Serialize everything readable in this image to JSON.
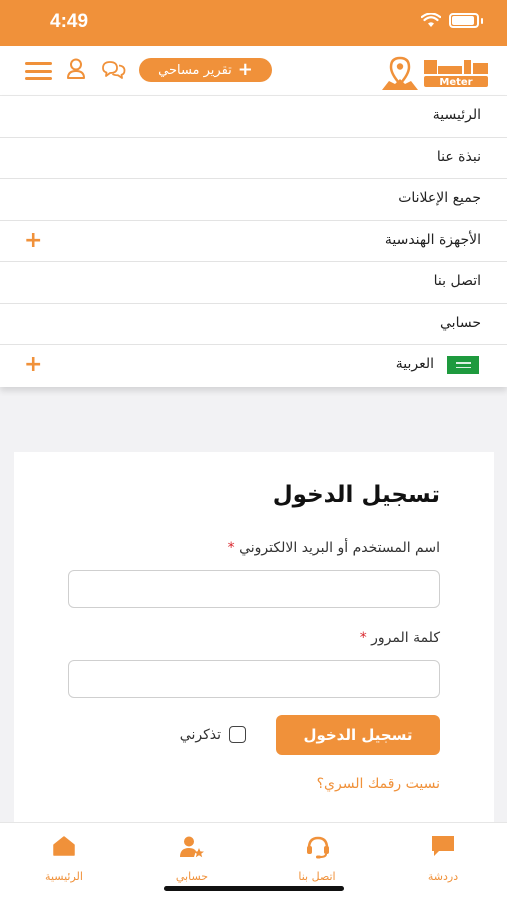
{
  "status": {
    "time": "4:49"
  },
  "header": {
    "report_button": "تقرير مساحي",
    "logo_text": "Meter"
  },
  "menu": {
    "items": [
      {
        "label": "الرئيسية"
      },
      {
        "label": "نبذة عنا"
      },
      {
        "label": "جميع الإعلانات"
      },
      {
        "label": "الأجهزة الهندسية"
      },
      {
        "label": "اتصل بنا"
      },
      {
        "label": "حسابي"
      },
      {
        "label": "العربية"
      }
    ]
  },
  "login": {
    "title": "تسجيل الدخول",
    "username_label": "اسم المستخدم أو البريد الالكتروني",
    "password_label": "كلمة المرور",
    "required_mark": "*",
    "username_value": "",
    "password_value": "",
    "login_button": "تسجيل الدخول",
    "remember_me": "تذكرني",
    "forgot_password": "نسيت رقمك السري؟"
  },
  "tabbar": {
    "home": "الرئيسية",
    "account": "حسابي",
    "contact": "اتصل بنا",
    "chat": "دردشة"
  },
  "colors": {
    "accent": "#f0913a",
    "required": "#d9262c"
  },
  "icons": [
    "wifi-icon",
    "battery-icon",
    "menu-icon",
    "user-icon",
    "chat-icon",
    "plus-icon",
    "home-icon",
    "account-icon",
    "headset-icon",
    "chat-bubble-icon",
    "saudi-flag-icon"
  ]
}
